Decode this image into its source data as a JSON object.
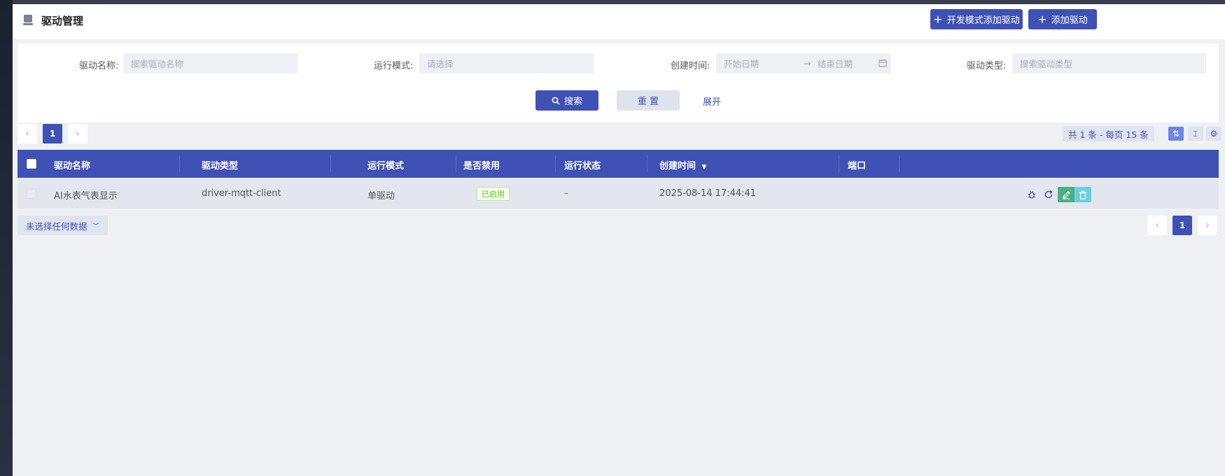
{
  "header": {
    "title": "驱动管理",
    "dev_add_button": "开发模式添加驱动",
    "add_button": "添加驱动"
  },
  "filters": {
    "driver_name_label": "驱动名称:",
    "driver_name_placeholder": "搜索驱动名称",
    "run_mode_label": "运行模式:",
    "run_mode_placeholder": "请选择",
    "created_label": "创建时间:",
    "start_date_placeholder": "开始日期",
    "end_date_placeholder": "结束日期",
    "driver_type_label": "驱动类型:",
    "driver_type_placeholder": "搜索驱动类型",
    "search_button": "搜索",
    "reset_button": "重 置",
    "expand_link": "展开"
  },
  "pagination": {
    "current_page": "1",
    "total_text": "共 1 条 - 每页 15 条"
  },
  "table": {
    "columns": [
      "驱动名称",
      "驱动类型",
      "运行模式",
      "是否禁用",
      "运行状态",
      "创建时间",
      "端口"
    ],
    "rows": [
      {
        "name": "AI水表气表显示",
        "type": "driver-mqtt-client",
        "mode": "单驱动",
        "disabled_tag": "已启用",
        "status": "-",
        "created": "2025-08-14 17:44:41",
        "port": ""
      }
    ]
  },
  "footer": {
    "selection_text": "未选择任何数据"
  },
  "colors": {
    "primary": "#3f51b5",
    "edit": "#4caf82",
    "delete": "#6ccfe0",
    "enabled_tag": "#52c41a"
  }
}
